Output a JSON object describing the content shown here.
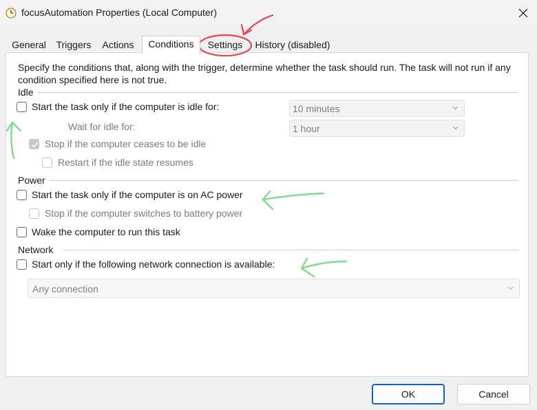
{
  "window": {
    "title": "focusAutomation Properties (Local Computer)",
    "app_icon": "task-scheduler-clock-icon",
    "close_icon": "close-icon"
  },
  "tabs": [
    {
      "label": "General",
      "active": false
    },
    {
      "label": "Triggers",
      "active": false
    },
    {
      "label": "Actions",
      "active": false
    },
    {
      "label": "Conditions",
      "active": true
    },
    {
      "label": "Settings",
      "active": false
    },
    {
      "label": "History (disabled)",
      "active": false
    }
  ],
  "description": "Specify the conditions that, along with the trigger, determine whether the task should run.  The task will not run  if any condition specified here is not true.",
  "idle": {
    "section_label": "Idle",
    "start_if_idle": {
      "label": "Start the task only if the computer is idle for:",
      "checked": false
    },
    "idle_duration": "10 minutes",
    "wait_label": "Wait for idle for:",
    "wait_duration": "1 hour",
    "stop_if_ceases": {
      "label": "Stop if the computer ceases to be idle",
      "checked": true,
      "enabled": false
    },
    "restart_if_resumes": {
      "label": "Restart if the idle state resumes",
      "checked": false,
      "enabled": false
    }
  },
  "power": {
    "section_label": "Power",
    "start_on_ac": {
      "label": "Start the task only if the computer is on AC power",
      "checked": false
    },
    "stop_on_battery": {
      "label": "Stop if the computer switches to battery power",
      "checked": false,
      "enabled": false
    },
    "wake_to_run": {
      "label": "Wake the computer to run this task",
      "checked": false
    }
  },
  "network": {
    "section_label": "Network",
    "start_if_network": {
      "label": "Start only if the following network connection is available:",
      "checked": false
    },
    "connection": "Any connection"
  },
  "buttons": {
    "ok": "OK",
    "cancel": "Cancel"
  },
  "annotation_colors": {
    "circle": "#e8434f",
    "arrows": "#7ddc8c"
  }
}
